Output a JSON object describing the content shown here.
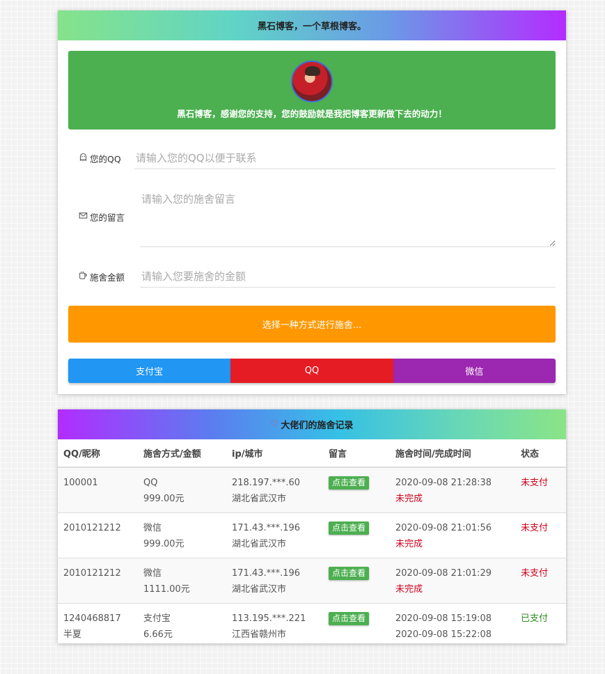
{
  "header": {
    "title": "黑石博客，一个草根博客。"
  },
  "banner": {
    "message": "黑石博客，感谢您的支持，您的鼓励就是我把博客更新做下去的动力！"
  },
  "form": {
    "qq_label": "您的QQ",
    "qq_placeholder": "请输入您的QQ以便于联系",
    "message_label": "您的留言",
    "message_placeholder": "请输入您的施舍留言",
    "amount_label": "施舍金额",
    "amount_placeholder": "请输入您要施舍的金额"
  },
  "choose_button": "选择一种方式进行施舍...",
  "payment_methods": [
    "支付宝",
    "QQ",
    "微信"
  ],
  "records": {
    "title": "大佬们的施舍记录",
    "columns": [
      "QQ/昵称",
      "施舍方式/金额",
      "ip/城市",
      "留言",
      "施舍时间/完成时间",
      "状态"
    ],
    "view_label": "点击查看",
    "rows": [
      {
        "qq": "100001",
        "nickname": "",
        "method": "QQ",
        "amount": "999.00元",
        "ip": "218.197.***.60",
        "city": "湖北省武汉市",
        "time": "2020-09-08 21:28:38",
        "finish": "未完成",
        "status": "未支付"
      },
      {
        "qq": "2010121212",
        "nickname": "",
        "method": "微信",
        "amount": "999.00元",
        "ip": "171.43.***.196",
        "city": "湖北省武汉市",
        "time": "2020-09-08 21:01:56",
        "finish": "未完成",
        "status": "未支付"
      },
      {
        "qq": "2010121212",
        "nickname": "",
        "method": "微信",
        "amount": "1111.00元",
        "ip": "171.43.***.196",
        "city": "湖北省武汉市",
        "time": "2020-09-08 21:01:29",
        "finish": "未完成",
        "status": "未支付"
      },
      {
        "qq": "1240468817",
        "nickname": "半夏",
        "method": "支付宝",
        "amount": "6.66元",
        "ip": "113.195.***.221",
        "city": "江西省赣州市",
        "time": "2020-09-08 15:19:08",
        "finish": "2020-09-08 15:22:08",
        "status": "已支付"
      }
    ]
  },
  "colors": {
    "banner": "#4caf50",
    "orange": "#ff9800",
    "alipay": "#2196f3",
    "qq": "#e51c23",
    "wechat": "#9c27b0",
    "unpaid": "#d0021b",
    "paid": "#2e8b22"
  },
  "icons": {
    "qq": "ghost-icon",
    "message": "envelope-icon",
    "amount": "cup-icon",
    "records": "heart-icon"
  }
}
